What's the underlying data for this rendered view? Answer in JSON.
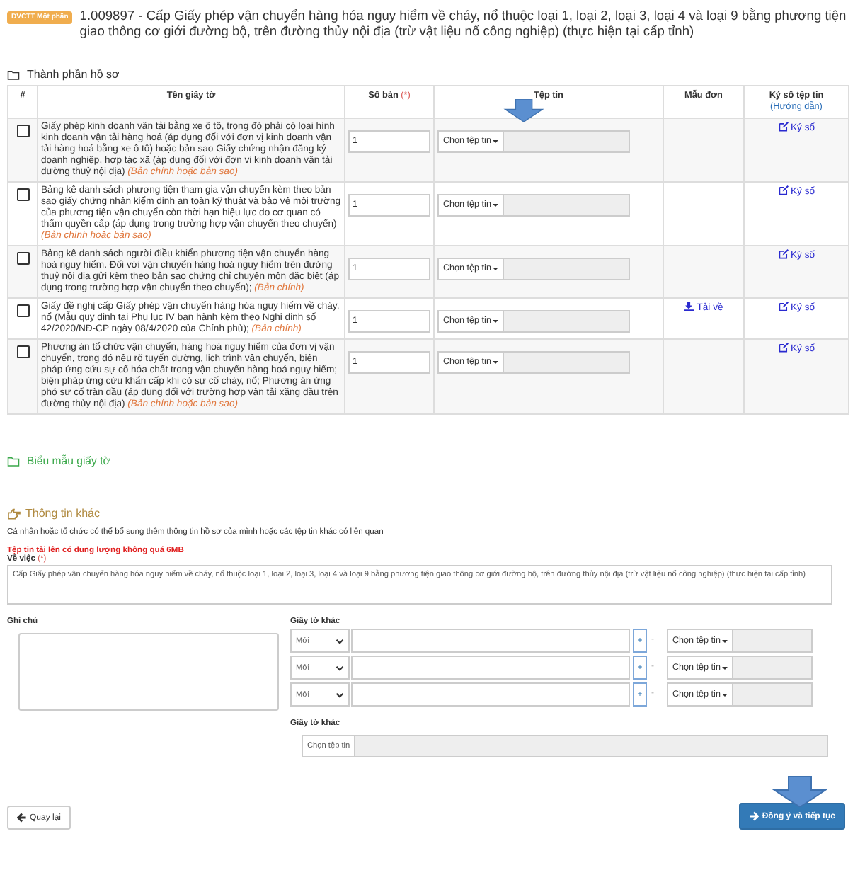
{
  "header": {
    "badge": "DVCTT Một phần",
    "title": "1.009897 - Cấp Giấy phép vận chuyển hàng hóa nguy hiểm về cháy, nổ thuộc loại 1, loại 2, loại 3, loại 4 và loại 9 bằng phương tiện giao thông cơ giới đường bộ, trên đường thủy nội địa (trừ vật liệu nổ công nghiệp) (thực hiện tại cấp tỉnh)"
  },
  "documents_section": {
    "title": "Thành phần hồ sơ",
    "columns": {
      "index": "#",
      "name": "Tên giấy tờ",
      "copies": "Số bản",
      "copies_required": "(*)",
      "file": "Tệp tin",
      "template": "Mẫu đơn",
      "sign": "Ký số tệp tin",
      "sign_help": "(Hướng dẫn)"
    },
    "rows": [
      {
        "checked": false,
        "name": "Giấy phép kinh doanh vận tải bằng xe ô tô, trong đó phải có loại hình kinh doanh vận tải hàng hoá (áp dụng đối với đơn vị kinh doanh vận tải hàng hoá bằng xe ô tô) hoặc bản sao Giấy chứng nhận đăng ký doanh nghiệp, hợp tác xã (áp dụng đối với đơn vị kinh doanh vận tải đường thuỷ nội địa)",
        "note": "(Bản chính hoặc bản sao)",
        "copies": "1",
        "file_button": "Chọn tệp tin",
        "sign": "Ký số"
      },
      {
        "checked": false,
        "name": "Bảng kê danh sách phương tiện tham gia vận chuyển kèm theo bản sao giấy chứng nhận kiểm định an toàn kỹ thuật và bảo vệ môi trường của phương tiện vận chuyển còn thời hạn hiệu lực do cơ quan có thẩm quyền cấp (áp dụng trong trường hợp vận chuyển theo chuyến)",
        "note": "(Bản chính hoặc bản sao)",
        "copies": "1",
        "file_button": "Chọn tệp tin",
        "sign": "Ký số"
      },
      {
        "checked": false,
        "name": "Bảng kê danh sách người điều khiển phương tiện vận chuyển hàng hoá nguy hiểm. Đối với vận chuyển hàng hoá nguy hiểm trên đường thuỷ nội địa gửi kèm theo bản sao chứng chỉ chuyên môn đặc biệt (áp dụng trong trường hợp vận chuyển theo chuyến);",
        "note": "(Bản chính)",
        "copies": "1",
        "file_button": "Chọn tệp tin",
        "sign": "Ký số"
      },
      {
        "checked": false,
        "name": "Giấy đề nghị cấp Giấy phép vận chuyển hàng hóa nguy hiểm về cháy, nổ (Mẫu quy định tại Phụ lục IV ban hành kèm theo Nghị định số 42/2020/NĐ-CP ngày 08/4/2020 của Chính phủ);",
        "note": "(Bản chính)",
        "copies": "1",
        "file_button": "Chọn tệp tin",
        "template": "Tải về",
        "sign": "Ký số"
      },
      {
        "checked": false,
        "name": "Phương án tổ chức vận chuyển, hàng hoá nguy hiểm của đơn vị vận chuyển, trong đó nêu rõ tuyến đường, lịch trình vận chuyển, biện pháp ứng cứu sự cố hóa chất trong vận chuyển hàng hoá nguy hiểm; biện pháp ứng cứu khẩn cấp khi có sự cố cháy, nổ; Phương án ứng phó sự cố tràn dầu (áp dụng đối với trường hợp vận tải xăng dầu trên đường thủy nội địa)",
        "note": "(Bản chính hoặc bản sao)",
        "copies": "1",
        "file_button": "Chọn tệp tin",
        "sign": "Ký số"
      }
    ]
  },
  "templates_link": "Biểu mẫu giấy tờ",
  "other_info": {
    "title": "Thông tin khác",
    "description": "Cá nhân hoặc tổ chức có thể bổ sung thêm thông tin hồ sơ của mình hoặc các tệp tin khác có liên quan",
    "size_warning": "Tệp tin tải lên có dung lượng không quá 6MB",
    "subject_label": "Về việc",
    "subject_required": "(*)",
    "subject_value": "Cấp Giấy phép vận chuyển hàng hóa nguy hiểm về cháy, nổ thuộc loại 1, loại 2, loại 3, loại 4 và loại 9 bằng phương tiện giao thông cơ giới đường bộ, trên đường thủy nội địa (trừ vật liệu nổ công nghiệp) (thực hiện tại cấp tỉnh)",
    "notes_label": "Ghi chú",
    "other_docs_label": "Giấy tờ khác",
    "other_docs": [
      {
        "status": "Mới",
        "add": "+",
        "remove": "-",
        "file_button": "Chọn tệp tin"
      },
      {
        "status": "Mới",
        "add": "+",
        "remove": "-",
        "file_button": "Chọn tệp tin"
      },
      {
        "status": "Mới",
        "add": "+",
        "remove": "-",
        "file_button": "Chọn tệp tin"
      }
    ],
    "other_docs_label_2": "Giấy tờ khác",
    "single_file_button": "Chọn tệp tin"
  },
  "buttons": {
    "back": "Quay lại",
    "submit": "Đồng ý và tiếp tục"
  }
}
